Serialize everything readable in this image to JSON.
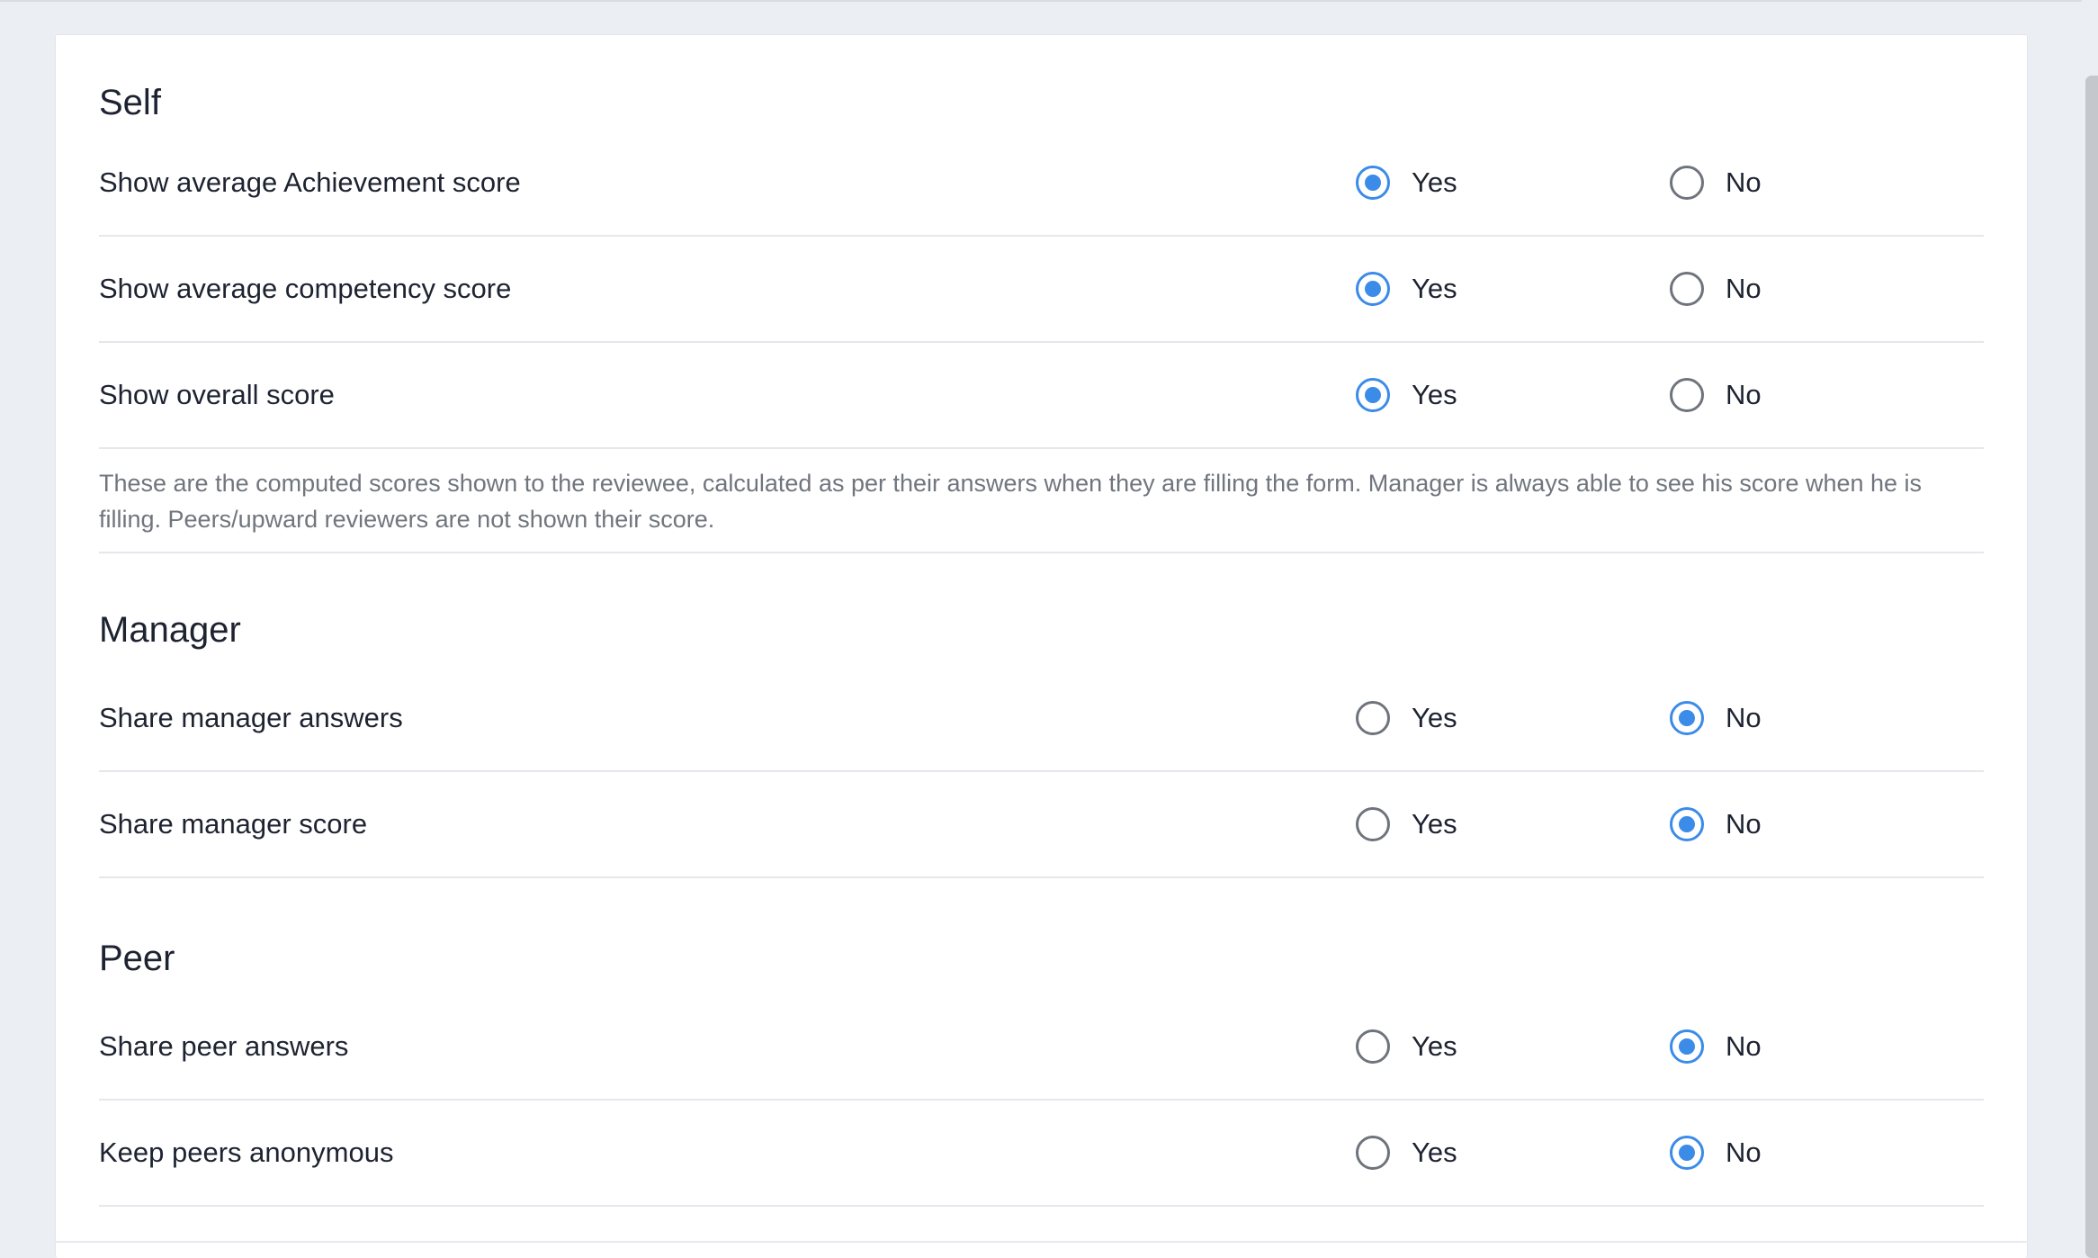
{
  "colors": {
    "accent": "#3b8be8",
    "background": "#ebeef2",
    "card": "#ffffff",
    "divider": "#e4e7eb",
    "note_text": "#70757e"
  },
  "sections": {
    "self": {
      "title": "Self",
      "rows": [
        {
          "label": "Show average Achievement score",
          "yes_label": "Yes",
          "no_label": "No",
          "selected": "Yes"
        },
        {
          "label": "Show average competency score",
          "yes_label": "Yes",
          "no_label": "No",
          "selected": "Yes"
        },
        {
          "label": "Show overall score",
          "yes_label": "Yes",
          "no_label": "No",
          "selected": "Yes"
        }
      ],
      "note": "These are the computed scores shown to the reviewee, calculated as per their answers when they are filling the form. Manager is always able to see his score when he is filling. Peers/upward reviewers are not shown their score."
    },
    "manager": {
      "title": "Manager",
      "rows": [
        {
          "label": "Share manager answers",
          "yes_label": "Yes",
          "no_label": "No",
          "selected": "No"
        },
        {
          "label": "Share manager score",
          "yes_label": "Yes",
          "no_label": "No",
          "selected": "No"
        }
      ]
    },
    "peer": {
      "title": "Peer",
      "rows": [
        {
          "label": "Share peer answers",
          "yes_label": "Yes",
          "no_label": "No",
          "selected": "No"
        },
        {
          "label": "Keep peers anonymous",
          "yes_label": "Yes",
          "no_label": "No",
          "selected": "No"
        }
      ]
    }
  }
}
